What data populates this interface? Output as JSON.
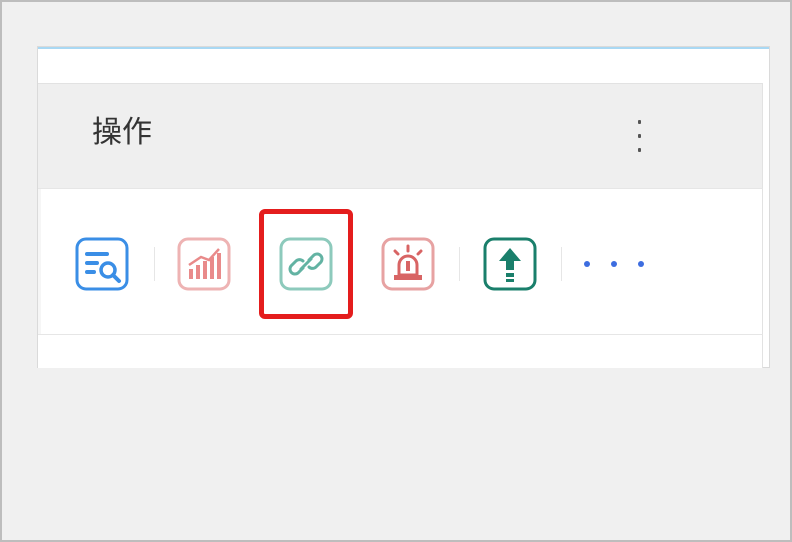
{
  "header": {
    "title": "操作"
  },
  "actions": {
    "buttons": [
      {
        "name": "query-detail",
        "icon": "list-search-icon",
        "color": "#3a8ee6"
      },
      {
        "name": "statistics",
        "icon": "bar-chart-icon",
        "color": "#e98a8a"
      },
      {
        "name": "link",
        "icon": "link-icon",
        "color": "#63b3a3"
      },
      {
        "name": "alarm",
        "icon": "alarm-light-icon",
        "color": "#d86464"
      },
      {
        "name": "upload",
        "icon": "upload-arrow-icon",
        "color": "#1a7f6b"
      }
    ],
    "more_color": "#3d6de0"
  },
  "colors": {
    "highlight": "#e41d1d",
    "accent_line": "#a9d8f3"
  }
}
